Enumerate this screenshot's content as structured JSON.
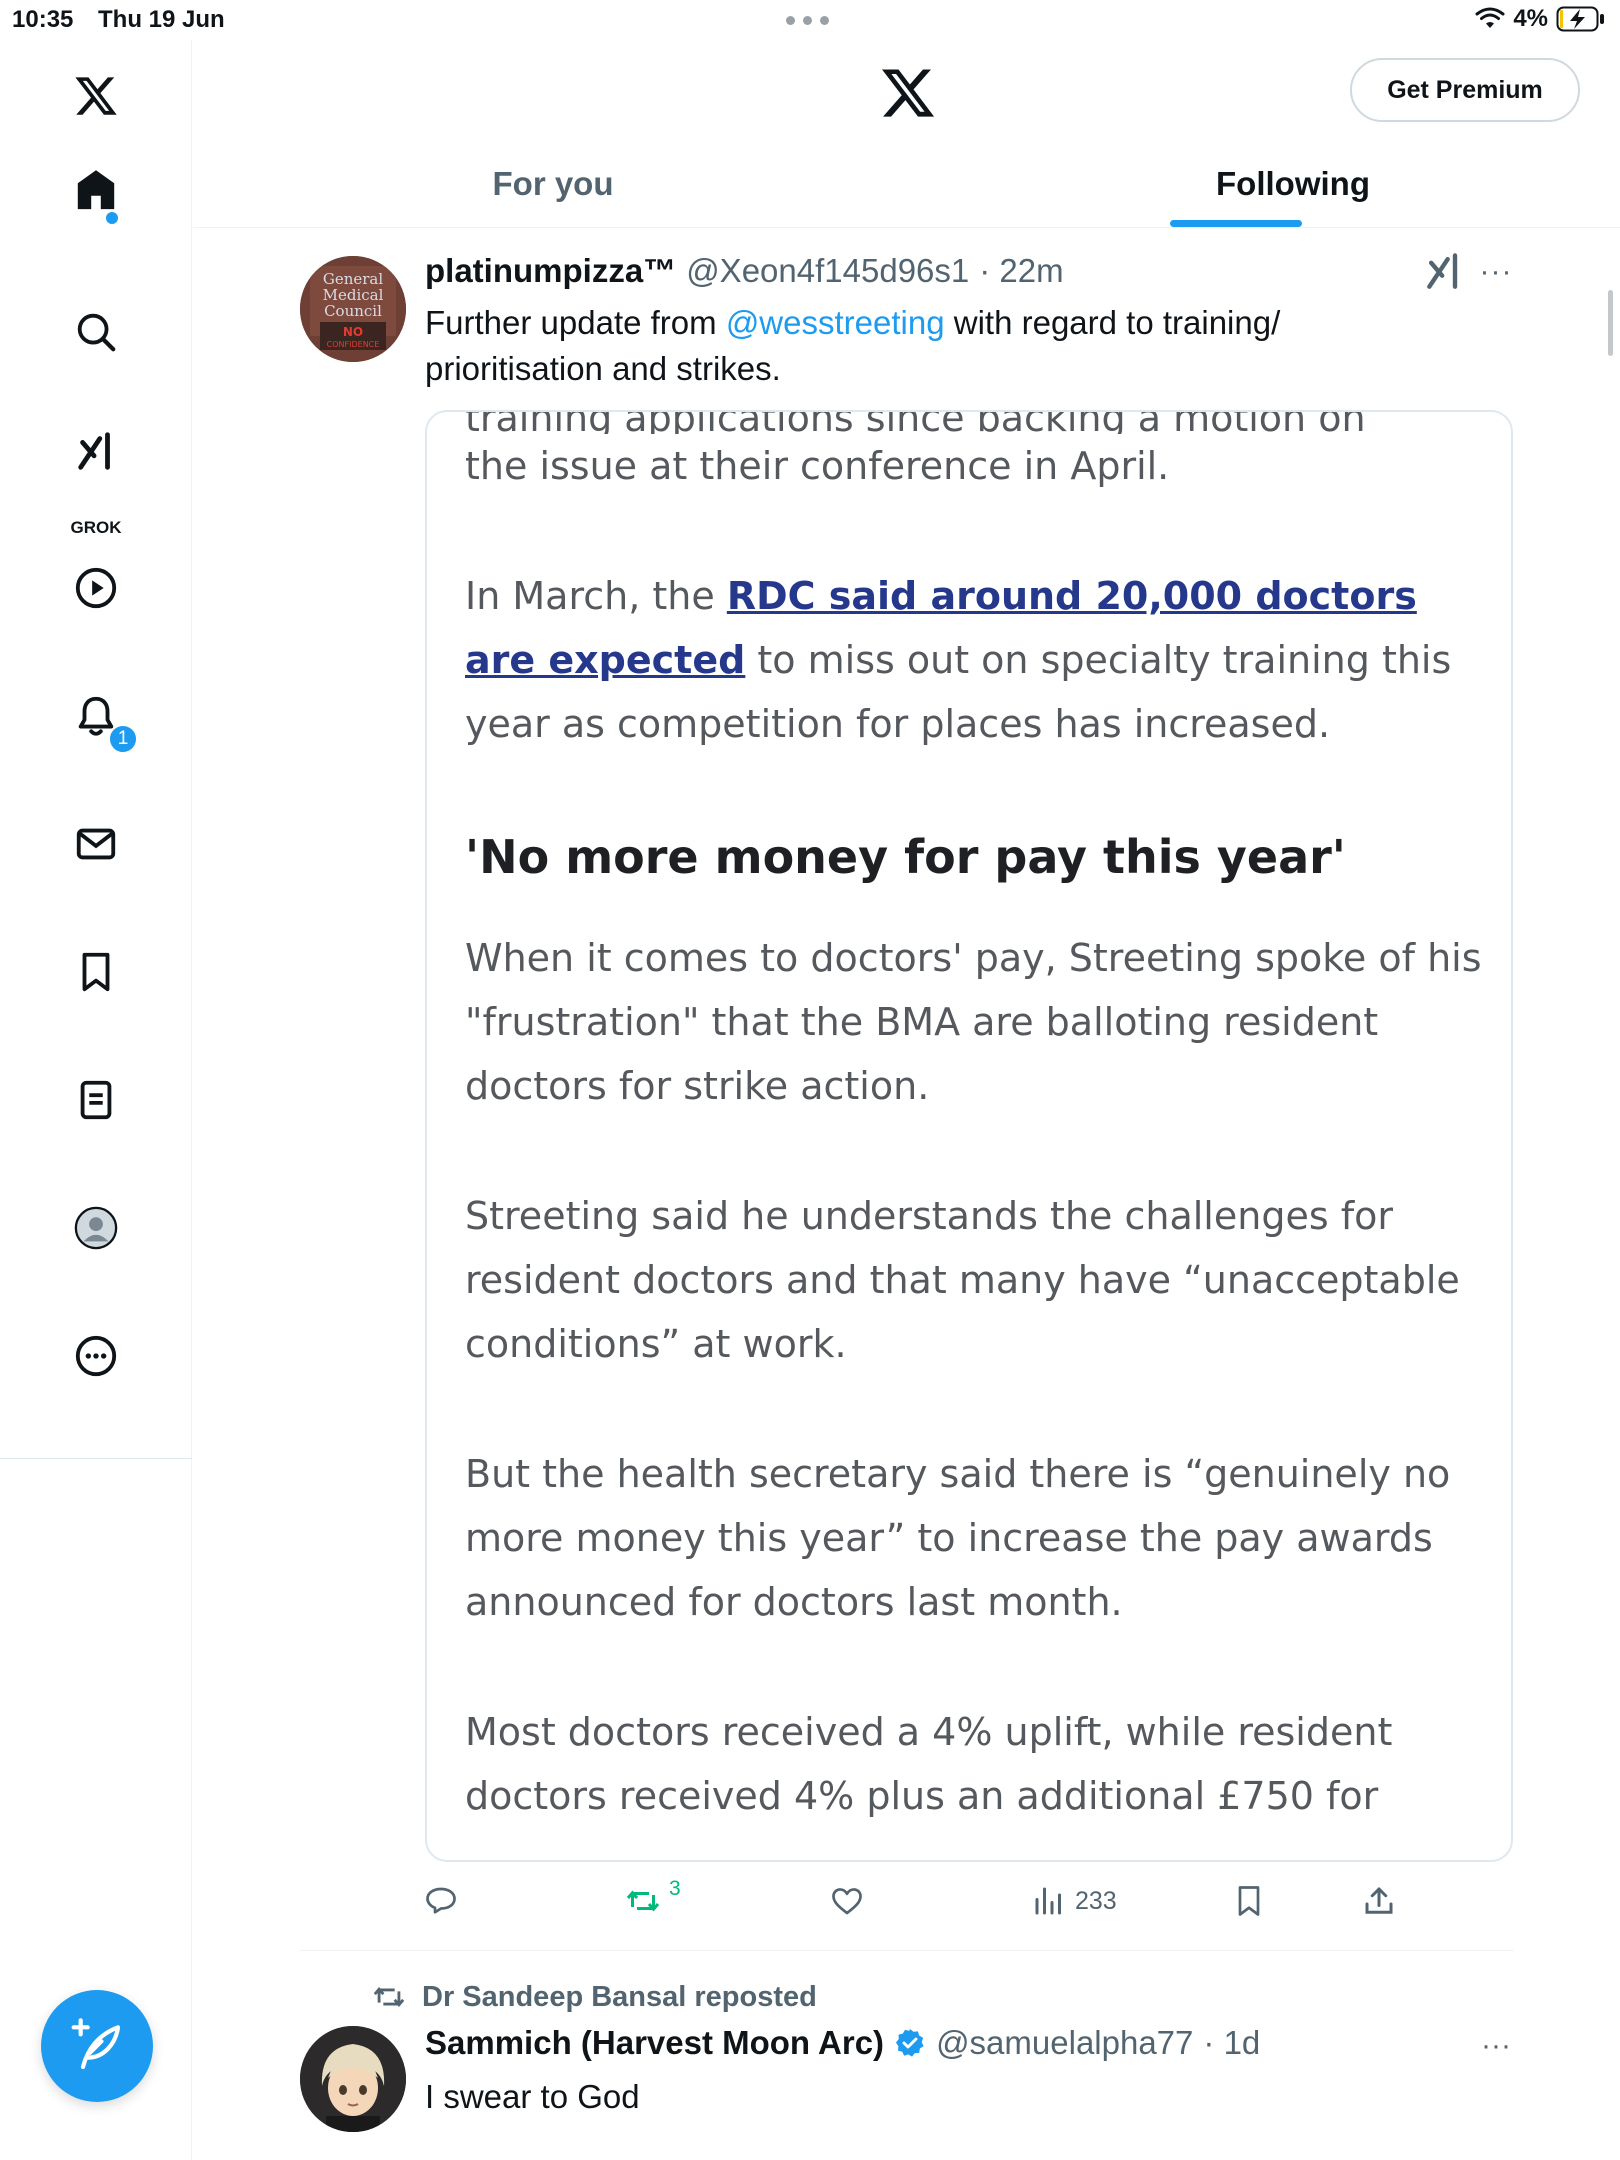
{
  "status_bar": {
    "time": "10:35",
    "date": "Thu 19 Jun",
    "battery": "4%"
  },
  "sidebar": {
    "grok_label": "GROK",
    "notifications_badge": "1"
  },
  "header": {
    "premium_label": "Get Premium",
    "tabs": [
      {
        "label": "For you"
      },
      {
        "label": "Following"
      }
    ]
  },
  "post1": {
    "name": "platinumpizza™",
    "handle": "@Xeon4f145d96s1",
    "time": "· 22m",
    "text_before": "Further update from ",
    "mention": "@wesstreeting",
    "text_after": " with regard to training/ prioritisation and strikes.",
    "avatar_text": [
      "General",
      "Medical",
      "Council",
      "NO",
      "CONFIDENCE"
    ],
    "article": {
      "cut_line": "training applications since backing a motion on",
      "p0": "the issue at their conference in April.",
      "p1_before": "In March, the ",
      "p1_link": "RDC said around 20,000 doctors are expected",
      "p1_after": " to miss out on specialty training this year as competition for places has increased.",
      "heading": "'No more money for pay this year'",
      "p2": "When it comes to doctors' pay, Streeting spoke of his \"frustration\" that the BMA are balloting resident doctors for strike action.",
      "p3": "Streeting said he understands the challenges for resident doctors and that many have “unacceptable conditions” at work.",
      "p4": "But the health secretary said there is “genuinely no more money this year” to increase the pay awards announced for doctors last month.",
      "p5": "Most doctors received a 4% uplift, while resident doctors received 4% plus an additional £750 for"
    },
    "stats": {
      "reposts": "3",
      "views": "233"
    }
  },
  "post2": {
    "repost_by": "Dr Sandeep Bansal reposted",
    "name": "Sammich (Harvest Moon Arc)",
    "handle": "@samuelalpha77",
    "time": "· 1d",
    "text": "I swear to God"
  },
  "colors": {
    "accent": "#1d9bf0",
    "repost_green": "#00ba7c",
    "muted": "#536471"
  }
}
